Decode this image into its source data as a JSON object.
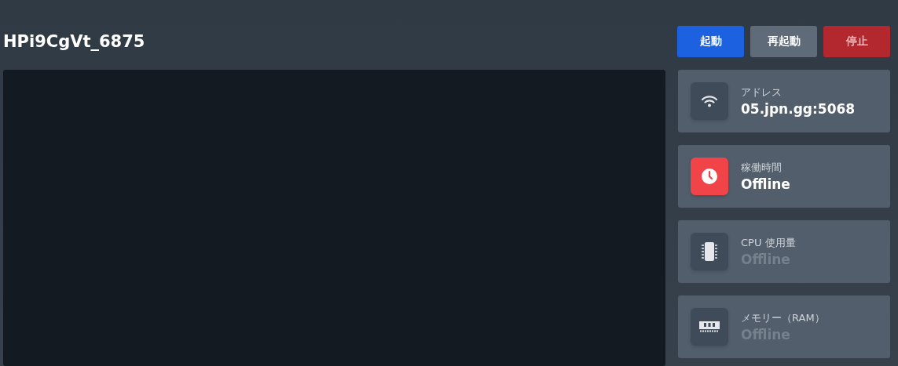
{
  "server": {
    "name": "HPi9CgVt_6875"
  },
  "buttons": [
    {
      "label": "起動",
      "kind": "start",
      "disabled": false
    },
    {
      "label": "再起動",
      "kind": "restart",
      "disabled": false
    },
    {
      "label": "停止",
      "kind": "stop",
      "disabled": true
    }
  ],
  "stats": [
    {
      "kind": "address",
      "label": "アドレス",
      "value": "05.jpn.gg:5068",
      "alert": false,
      "dimmed": false
    },
    {
      "kind": "uptime",
      "label": "稼働時間",
      "value": "Offline",
      "alert": true,
      "dimmed": false
    },
    {
      "kind": "cpu",
      "label": "CPU 使用量",
      "value": "Offline",
      "alert": false,
      "dimmed": true
    },
    {
      "kind": "memory",
      "label": "メモリー（RAM）",
      "value": "Offline",
      "alert": false,
      "dimmed": true
    }
  ]
}
